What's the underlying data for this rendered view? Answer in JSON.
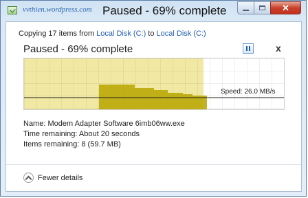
{
  "window": {
    "watermark": "vvthien.wordpress.com",
    "title": "Paused - 69% complete",
    "controls": {
      "minimize": "minimize",
      "maximize": "maximize",
      "close": "✕"
    }
  },
  "dialog": {
    "copying_prefix": "Copying 17 items from ",
    "source": "Local Disk (C:)",
    "copying_middle": " to ",
    "destination": "Local Disk (C:)",
    "status": "Paused - 69% complete",
    "close_glyph": "x"
  },
  "graph": {
    "progress_fraction": 0.69,
    "speed_label": "Speed: 26.0 MB/s"
  },
  "details": {
    "name_label": "Name:",
    "name_value": "Modem Adapter Software 6imb06ww.exe",
    "time_label": "Time remaining:",
    "time_value": "About 20 seconds",
    "items_label": "Items remaining:",
    "items_value": "8 (59.7 MB)"
  },
  "footer": {
    "fewer_details": "Fewer details"
  },
  "colors": {
    "accent": "#1f5fb0",
    "progress": "#f1e9a3",
    "throughput": "#b8a400"
  }
}
